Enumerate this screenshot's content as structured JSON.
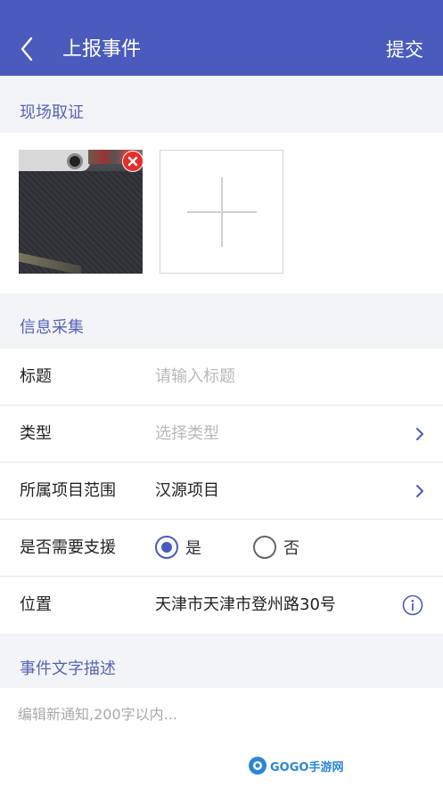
{
  "header": {
    "title": "上报事件",
    "submit_label": "提交"
  },
  "evidence": {
    "section_title": "现场取证"
  },
  "info": {
    "section_title": "信息采集",
    "title_label": "标题",
    "title_placeholder": "请输入标题",
    "type_label": "类型",
    "type_placeholder": "选择类型",
    "project_label": "所属项目范围",
    "project_value": "汉源项目",
    "support_label": "是否需要支援",
    "support_yes": "是",
    "support_no": "否",
    "support_selected": "是",
    "location_label": "位置",
    "location_value": "天津市天津市登州路30号"
  },
  "description": {
    "section_title": "事件文字描述",
    "placeholder": "编辑新通知,200字以内..."
  },
  "watermark": {
    "text": "GOGO手游网"
  },
  "colors": {
    "primary": "#4a5bbd",
    "section_text": "#5665b4",
    "danger": "#e52d2d"
  }
}
